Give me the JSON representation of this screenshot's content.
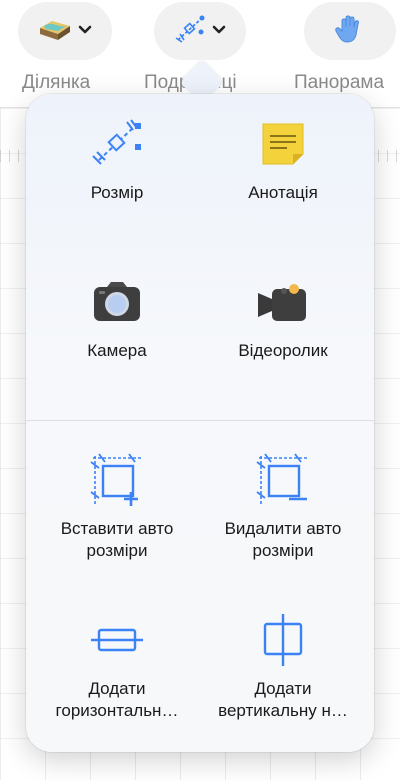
{
  "toolbar": {
    "buttons": [
      {
        "name": "site",
        "label": "Ділянка",
        "icon": "terrain-icon"
      },
      {
        "name": "details",
        "label": "Подробиці",
        "icon": "dimension-icon"
      },
      {
        "name": "panorama",
        "label": "Панорама",
        "icon": "hand-icon"
      }
    ],
    "chevron_icon": "chevron-down-icon"
  },
  "menu": {
    "items": [
      {
        "label": "Розмір",
        "icon": "dimension-icon"
      },
      {
        "label": "Анотація",
        "icon": "note-icon"
      },
      {
        "label": "Камера",
        "icon": "camera-icon"
      },
      {
        "label": "Відеоролик",
        "icon": "video-camera-icon"
      },
      {
        "label_line1": "Вставити авто",
        "label_line2": "розміри",
        "icon": "auto-dimension-add-icon"
      },
      {
        "label_line1": "Видалити авто",
        "label_line2": "розміри",
        "icon": "auto-dimension-remove-icon"
      },
      {
        "label_line1": "Додати",
        "label_line2": "горизонтальн…",
        "icon": "horizontal-guide-icon"
      },
      {
        "label_line1": "Додати",
        "label_line2": "вертикальну н…",
        "icon": "vertical-guide-icon"
      }
    ]
  },
  "colors": {
    "accent": "#3b82f6",
    "note": "#f3d23c",
    "dark_icon": "#3a3a3a"
  }
}
